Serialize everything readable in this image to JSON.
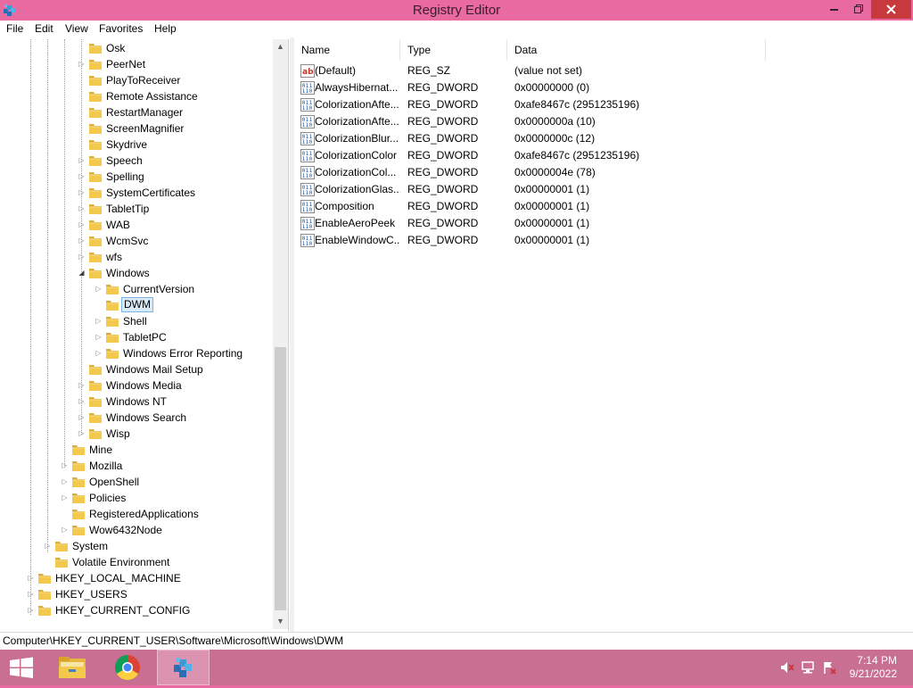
{
  "window": {
    "title": "Registry Editor"
  },
  "menu": [
    "File",
    "Edit",
    "View",
    "Favorites",
    "Help"
  ],
  "tree": [
    {
      "label": "Osk",
      "level": 4,
      "expander": "none"
    },
    {
      "label": "PeerNet",
      "level": 4,
      "expander": "collapsed"
    },
    {
      "label": "PlayToReceiver",
      "level": 4,
      "expander": "none"
    },
    {
      "label": "Remote Assistance",
      "level": 4,
      "expander": "none"
    },
    {
      "label": "RestartManager",
      "level": 4,
      "expander": "none"
    },
    {
      "label": "ScreenMagnifier",
      "level": 4,
      "expander": "none"
    },
    {
      "label": "Skydrive",
      "level": 4,
      "expander": "none"
    },
    {
      "label": "Speech",
      "level": 4,
      "expander": "collapsed"
    },
    {
      "label": "Spelling",
      "level": 4,
      "expander": "collapsed"
    },
    {
      "label": "SystemCertificates",
      "level": 4,
      "expander": "collapsed"
    },
    {
      "label": "TabletTip",
      "level": 4,
      "expander": "collapsed"
    },
    {
      "label": "WAB",
      "level": 4,
      "expander": "collapsed"
    },
    {
      "label": "WcmSvc",
      "level": 4,
      "expander": "collapsed"
    },
    {
      "label": "wfs",
      "level": 4,
      "expander": "collapsed"
    },
    {
      "label": "Windows",
      "level": 4,
      "expander": "expanded"
    },
    {
      "label": "CurrentVersion",
      "level": 5,
      "expander": "collapsed"
    },
    {
      "label": "DWM",
      "level": 5,
      "expander": "none",
      "selected": true
    },
    {
      "label": "Shell",
      "level": 5,
      "expander": "collapsed"
    },
    {
      "label": "TabletPC",
      "level": 5,
      "expander": "collapsed"
    },
    {
      "label": "Windows Error Reporting",
      "level": 5,
      "expander": "collapsed"
    },
    {
      "label": "Windows Mail Setup",
      "level": 4,
      "expander": "none"
    },
    {
      "label": "Windows Media",
      "level": 4,
      "expander": "collapsed"
    },
    {
      "label": "Windows NT",
      "level": 4,
      "expander": "collapsed"
    },
    {
      "label": "Windows Search",
      "level": 4,
      "expander": "collapsed"
    },
    {
      "label": "Wisp",
      "level": 4,
      "expander": "collapsed"
    },
    {
      "label": "Mine",
      "level": 3,
      "expander": "none"
    },
    {
      "label": "Mozilla",
      "level": 3,
      "expander": "collapsed"
    },
    {
      "label": "OpenShell",
      "level": 3,
      "expander": "collapsed"
    },
    {
      "label": "Policies",
      "level": 3,
      "expander": "collapsed"
    },
    {
      "label": "RegisteredApplications",
      "level": 3,
      "expander": "none"
    },
    {
      "label": "Wow6432Node",
      "level": 3,
      "expander": "collapsed"
    },
    {
      "label": "System",
      "level": 2,
      "expander": "collapsed"
    },
    {
      "label": "Volatile Environment",
      "level": 2,
      "expander": "none"
    },
    {
      "label": "HKEY_LOCAL_MACHINE",
      "level": 1,
      "expander": "collapsed"
    },
    {
      "label": "HKEY_USERS",
      "level": 1,
      "expander": "collapsed"
    },
    {
      "label": "HKEY_CURRENT_CONFIG",
      "level": 1,
      "expander": "collapsed"
    }
  ],
  "columns": [
    "Name",
    "Type",
    "Data"
  ],
  "values": [
    {
      "name": "(Default)",
      "type": "REG_SZ",
      "data": "(value not set)",
      "kind": "string"
    },
    {
      "name": "AlwaysHibernat...",
      "type": "REG_DWORD",
      "data": "0x00000000 (0)",
      "kind": "binary"
    },
    {
      "name": "ColorizationAfte...",
      "type": "REG_DWORD",
      "data": "0xafe8467c (2951235196)",
      "kind": "binary"
    },
    {
      "name": "ColorizationAfte...",
      "type": "REG_DWORD",
      "data": "0x0000000a (10)",
      "kind": "binary"
    },
    {
      "name": "ColorizationBlur...",
      "type": "REG_DWORD",
      "data": "0x0000000c (12)",
      "kind": "binary"
    },
    {
      "name": "ColorizationColor",
      "type": "REG_DWORD",
      "data": "0xafe8467c (2951235196)",
      "kind": "binary"
    },
    {
      "name": "ColorizationCol...",
      "type": "REG_DWORD",
      "data": "0x0000004e (78)",
      "kind": "binary"
    },
    {
      "name": "ColorizationGlas...",
      "type": "REG_DWORD",
      "data": "0x00000001 (1)",
      "kind": "binary"
    },
    {
      "name": "Composition",
      "type": "REG_DWORD",
      "data": "0x00000001 (1)",
      "kind": "binary"
    },
    {
      "name": "EnableAeroPeek",
      "type": "REG_DWORD",
      "data": "0x00000001 (1)",
      "kind": "binary"
    },
    {
      "name": "EnableWindowC...",
      "type": "REG_DWORD",
      "data": "0x00000001 (1)",
      "kind": "binary"
    }
  ],
  "status": {
    "path": "Computer\\HKEY_CURRENT_USER\\Software\\Microsoft\\Windows\\DWM"
  },
  "taskbar": {
    "apps": [
      {
        "name": "start-button",
        "icon": "windows-logo-icon"
      },
      {
        "name": "file-explorer",
        "icon": "file-explorer-icon"
      },
      {
        "name": "chrome",
        "icon": "chrome-icon"
      },
      {
        "name": "registry-editor",
        "icon": "regedit-icon",
        "active": true
      }
    ],
    "tray": [
      "volume-muted-icon",
      "network-icon",
      "action-center-icon"
    ],
    "time": "7:14 PM",
    "date": "9/21/2022"
  },
  "colors": {
    "titlebar": "#e86aa0",
    "close_button": "#c7393d",
    "taskbar": "#c86f92",
    "selection": "#d9ebf9",
    "folder": "#f2c94c"
  }
}
